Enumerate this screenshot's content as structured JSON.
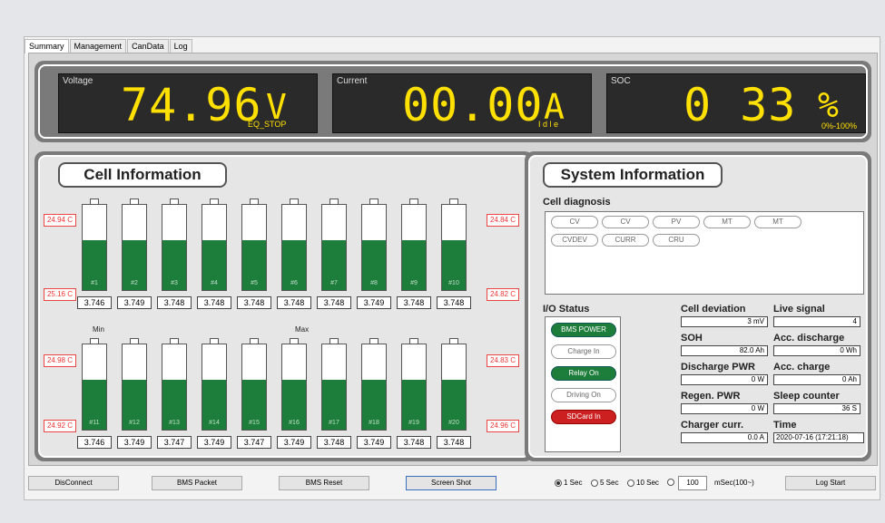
{
  "tabs": [
    "Summary",
    "Management",
    "CanData",
    "Log"
  ],
  "top": {
    "voltage": {
      "label": "Voltage",
      "value": "74.96",
      "unit": "V",
      "sub": "EQ_STOP"
    },
    "current": {
      "label": "Current",
      "value": "00.00",
      "unit": "A",
      "sub": "I d l e"
    },
    "soc": {
      "label": "SOC",
      "value": "0 33",
      "unit": "%",
      "sub": "0%-100%"
    }
  },
  "cell_info": {
    "title": "Cell Information",
    "row1": {
      "temp_left_top": "24.94 C",
      "temp_left_bottom": "25.16 C",
      "temp_right_top": "24.84 C",
      "temp_right_bottom": "24.82 C"
    },
    "row2": {
      "temp_left_top": "24.98 C",
      "temp_left_bottom": "24.92 C",
      "temp_right_top": "24.83 C",
      "temp_right_bottom": "24.96 C"
    },
    "min_label": "Min",
    "max_label": "Max",
    "cells": [
      {
        "id": "#1",
        "v": "3.746",
        "fill": 0.33
      },
      {
        "id": "#2",
        "v": "3.749",
        "fill": 0.33
      },
      {
        "id": "#3",
        "v": "3.748",
        "fill": 0.33
      },
      {
        "id": "#4",
        "v": "3.748",
        "fill": 0.33
      },
      {
        "id": "#5",
        "v": "3.748",
        "fill": 0.33
      },
      {
        "id": "#6",
        "v": "3.748",
        "fill": 0.33
      },
      {
        "id": "#7",
        "v": "3.748",
        "fill": 0.33
      },
      {
        "id": "#8",
        "v": "3.749",
        "fill": 0.33
      },
      {
        "id": "#9",
        "v": "3.748",
        "fill": 0.33
      },
      {
        "id": "#10",
        "v": "3.748",
        "fill": 0.33
      },
      {
        "id": "#11",
        "v": "3.746",
        "fill": 0.33
      },
      {
        "id": "#12",
        "v": "3.749",
        "fill": 0.33
      },
      {
        "id": "#13",
        "v": "3.747",
        "fill": 0.33
      },
      {
        "id": "#14",
        "v": "3.749",
        "fill": 0.33
      },
      {
        "id": "#15",
        "v": "3.747",
        "fill": 0.33
      },
      {
        "id": "#16",
        "v": "3.749",
        "fill": 0.33
      },
      {
        "id": "#17",
        "v": "3.748",
        "fill": 0.33
      },
      {
        "id": "#18",
        "v": "3.749",
        "fill": 0.33
      },
      {
        "id": "#19",
        "v": "3.748",
        "fill": 0.33
      },
      {
        "id": "#20",
        "v": "3.748",
        "fill": 0.33
      }
    ]
  },
  "system": {
    "title": "System Information",
    "diag_title": "Cell diagnosis",
    "diag": [
      "CV",
      "CV",
      "PV",
      "MT",
      "MT",
      "CVDEV",
      "CURR",
      "CRU"
    ],
    "io_title": "I/O Status",
    "io": [
      {
        "label": "BMS POWER",
        "state": "on"
      },
      {
        "label": "Charge In",
        "state": "off"
      },
      {
        "label": "Relay On",
        "state": "on"
      },
      {
        "label": "Driving On",
        "state": "off"
      },
      {
        "label": "SDCard In",
        "state": "alert"
      }
    ],
    "stats": {
      "cell_deviation": {
        "label": "Cell deviation",
        "value": "3 mV"
      },
      "live_signal": {
        "label": "Live signal",
        "value": "4"
      },
      "soh": {
        "label": "SOH",
        "value": "82.0 Ah"
      },
      "acc_discharge": {
        "label": "Acc. discharge",
        "value": "0 Wh"
      },
      "discharge_pwr": {
        "label": "Discharge PWR",
        "value": "0 W"
      },
      "acc_charge": {
        "label": "Acc. charge",
        "value": "0 Ah"
      },
      "regen_pwr": {
        "label": "Regen. PWR",
        "value": "0 W"
      },
      "sleep_counter": {
        "label": "Sleep counter",
        "value": "36 S"
      },
      "charger_curr": {
        "label": "Charger curr.",
        "value": "0.0 A"
      },
      "time": {
        "label": "Time",
        "value": "2020-07-16 (17:21:18)"
      }
    }
  },
  "bottom": {
    "disconnect": "DisConnect",
    "bms_packet": "BMS Packet",
    "bms_reset": "BMS Reset",
    "screen_shot": "Screen Shot",
    "r1": "1 Sec",
    "r5": "5 Sec",
    "r10": "10 Sec",
    "ms_value": "100",
    "ms_label": "mSec(100~)",
    "log_start": "Log Start"
  },
  "colors": {
    "green": "#1d7d3a",
    "yellow": "#ffe000",
    "red": "#cc1f1f"
  }
}
